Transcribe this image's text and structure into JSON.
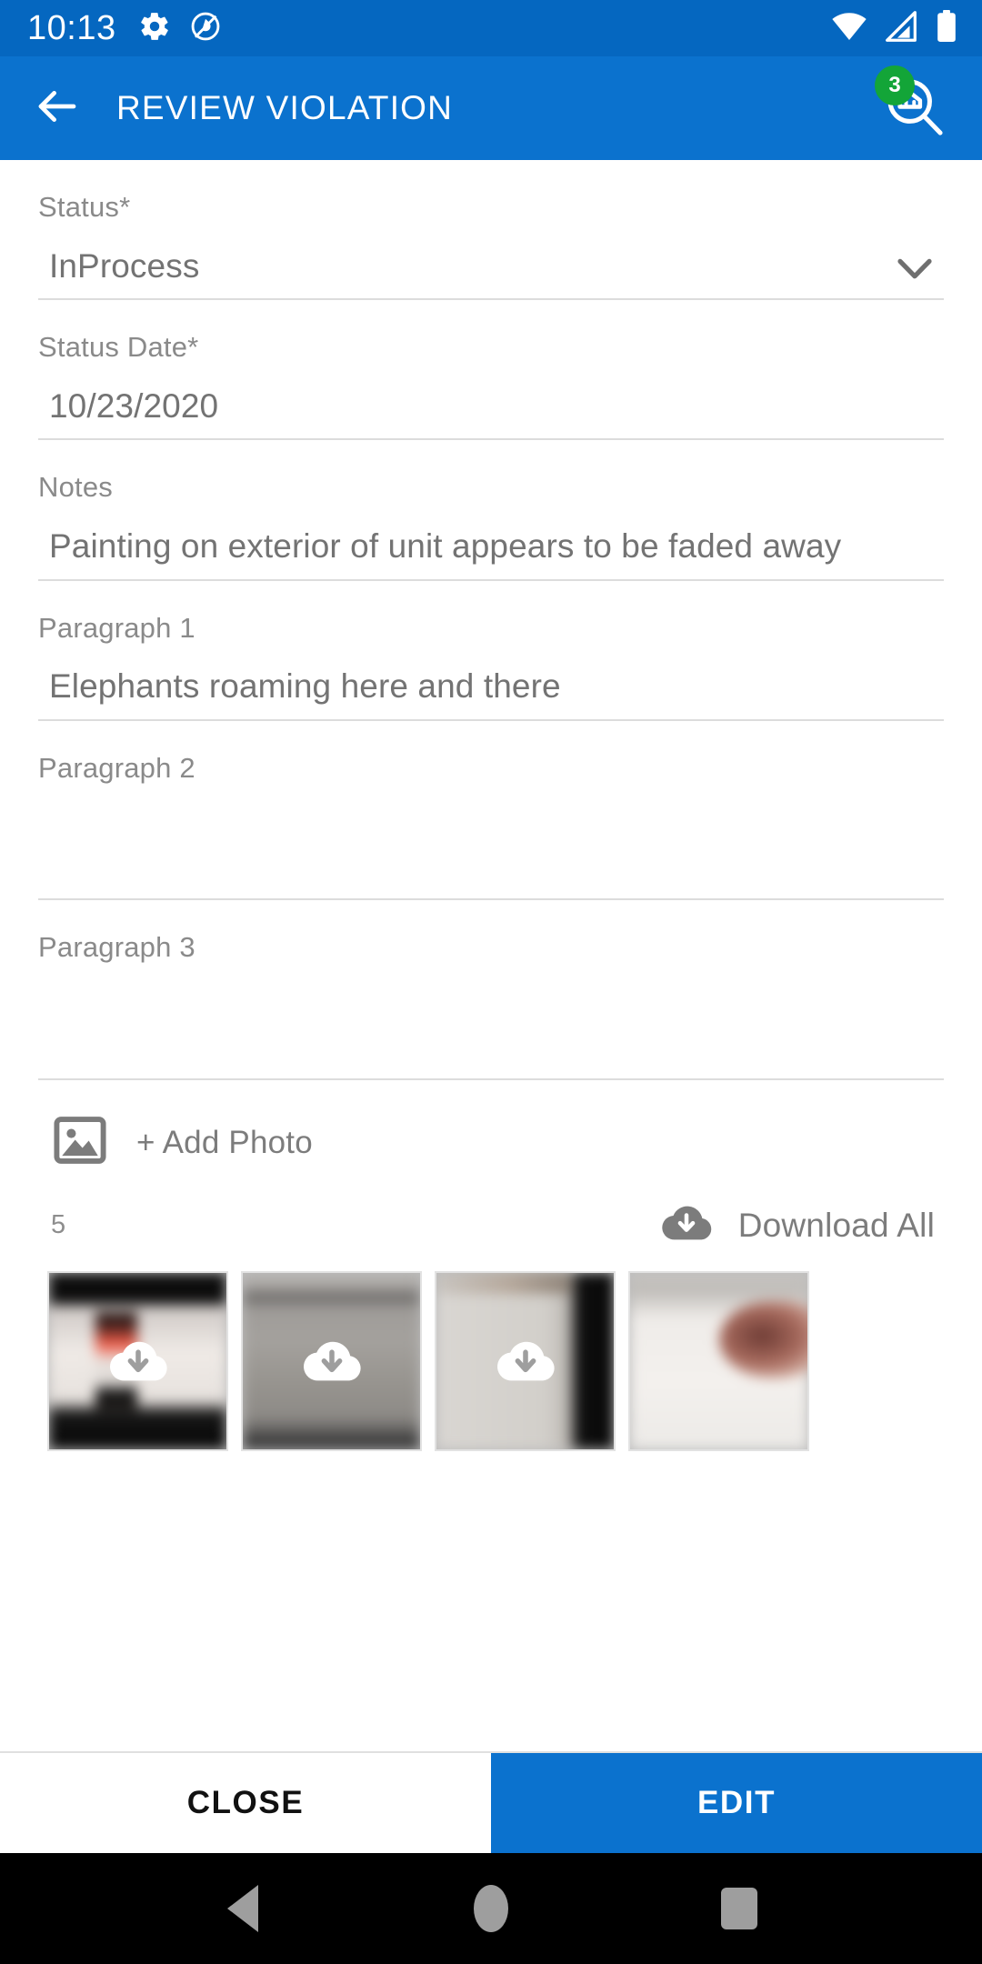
{
  "status_bar": {
    "clock": "10:13",
    "left_icons": [
      "gear-icon",
      "adblock-icon"
    ],
    "right_icons": [
      "wifi-icon",
      "cell-signal-icon",
      "battery-icon"
    ],
    "background_color": "#0567c0"
  },
  "app_bar": {
    "back_icon": "arrow-left-icon",
    "title": "REVIEW VIOLATION",
    "search_icon": "property-search-icon",
    "badge_count": "3",
    "badge_color": "#13a538",
    "background_color": "#0b72ce"
  },
  "form": {
    "fields": [
      {
        "label": "Status*",
        "value": "InProcess",
        "control": "dropdown",
        "name": "status"
      },
      {
        "label": "Status Date*",
        "value": "10/23/2020",
        "control": "date",
        "name": "status-date"
      },
      {
        "label": "Notes",
        "value": "Painting on exterior of unit appears to be faded away",
        "control": "text",
        "name": "notes"
      },
      {
        "label": "Paragraph 1",
        "value": "Elephants roaming here and there",
        "control": "text",
        "name": "paragraph-1"
      },
      {
        "label": "Paragraph 2",
        "value": "",
        "control": "text",
        "name": "paragraph-2"
      },
      {
        "label": "Paragraph 3",
        "value": "",
        "control": "text",
        "name": "paragraph-3"
      }
    ]
  },
  "photos": {
    "add_photo_label": "+ Add Photo",
    "add_photo_icon": "image-icon",
    "count": "5",
    "download_all_label": "Download All",
    "download_all_icon": "cloud-download-icon",
    "thumbnails": [
      {
        "id": "thumb-1",
        "overlay_icon": "cloud-download-icon",
        "has_overlay": true
      },
      {
        "id": "thumb-2",
        "overlay_icon": "cloud-download-icon",
        "has_overlay": true
      },
      {
        "id": "thumb-3",
        "overlay_icon": "cloud-download-icon",
        "has_overlay": true
      },
      {
        "id": "thumb-4",
        "overlay_icon": "cloud-download-icon",
        "has_overlay": false
      }
    ]
  },
  "actions": {
    "close_label": "CLOSE",
    "edit_label": "EDIT",
    "edit_color": "#0b72ce"
  },
  "nav_bar": {
    "back_icon": "triangle-back-icon",
    "home_icon": "circle-home-icon",
    "recents_icon": "square-recents-icon"
  }
}
